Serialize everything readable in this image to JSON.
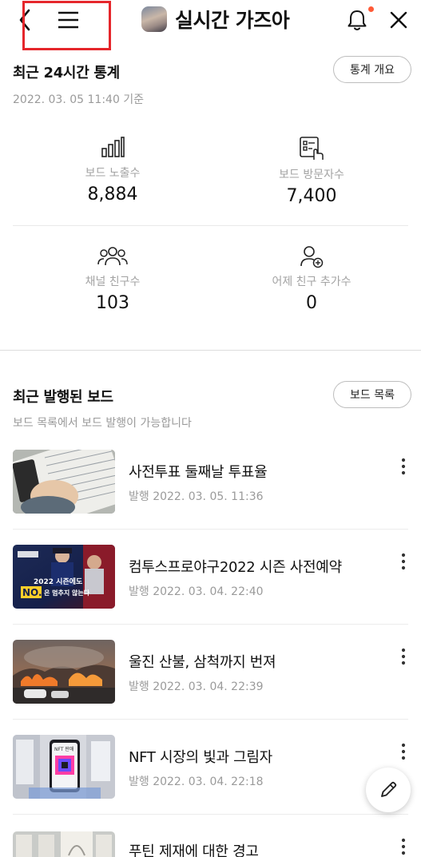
{
  "header": {
    "channel_name": "실시간 가즈아"
  },
  "stats_section": {
    "title": "최근 24시간 통계",
    "overview_button": "통계 개요",
    "timestamp": "2022. 03. 05 11:40 기준",
    "stats": [
      {
        "label": "보드 노출수",
        "value": "8,884",
        "icon": "bar-chart-icon"
      },
      {
        "label": "보드 방문자수",
        "value": "7,400",
        "icon": "board-visit-icon"
      },
      {
        "label": "채널 친구수",
        "value": "103",
        "icon": "friends-icon"
      },
      {
        "label": "어제 친구 추가수",
        "value": "0",
        "icon": "add-friend-icon"
      }
    ]
  },
  "boards_section": {
    "title": "최근 발행된 보드",
    "list_button": "보드 목록",
    "subtitle": "보드 목록에서 보드 발행이 가능합니다",
    "items": [
      {
        "title": "사전투표 둘째날 투표율",
        "date": "발행 2022. 03. 05. 11:36"
      },
      {
        "title": "컴투스프로야구2022 시즌 사전예약",
        "date": "발행 2022. 03. 04. 22:40"
      },
      {
        "title": "울진 산불, 삼척까지 번져",
        "date": "발행 2022. 03. 04. 22:39"
      },
      {
        "title": "NFT 시장의 빛과 그림자",
        "date": "발행 2022. 03. 04. 22:18"
      },
      {
        "title": "푸틴 제재에 대한 경고",
        "date": ""
      }
    ],
    "thumb_texts": {
      "baseball_line1": "2022 시즌에도",
      "baseball_line2": "NO.1",
      "baseball_line3": "은 멈추지 않는다",
      "nft_label": "NFT 판매"
    }
  },
  "colors": {
    "highlight": "#e5262b",
    "notification_dot": "#ff5a37"
  }
}
